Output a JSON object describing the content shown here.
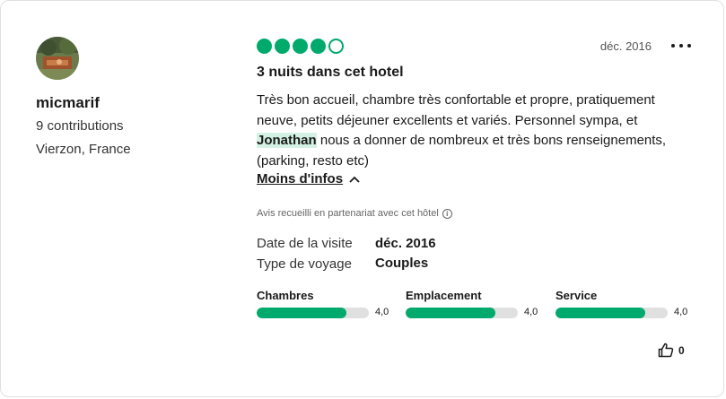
{
  "reviewer": {
    "name": "micmarif",
    "contributions": "9 contributions",
    "location": "Vierzon, France"
  },
  "review": {
    "rating": 4,
    "rating_max": 5,
    "date": "déc. 2016",
    "title": "3 nuits dans cet hotel",
    "text_before": "Très bon accueil, chambre très confortable et propre, pratiquement neuve, petits déjeuner excellents et variés. Personnel sympa, et ",
    "text_highlight": "Jonathan",
    "text_after": " nous a donner de nombreux et très bons renseignements, (parking, resto etc)",
    "less_link": "Moins d'infos",
    "partner_note": "Avis recueilli en partenariat avec cet hôtel",
    "details": [
      {
        "label": "Date de la visite",
        "value": "déc. 2016"
      },
      {
        "label": "Type de voyage",
        "value": "Couples"
      }
    ],
    "subscores": [
      {
        "label": "Chambres",
        "score": "4,0",
        "fraction": 0.8
      },
      {
        "label": "Emplacement",
        "score": "4,0",
        "fraction": 0.8
      },
      {
        "label": "Service",
        "score": "4,0",
        "fraction": 0.8
      }
    ],
    "helpful_count": "0"
  },
  "colors": {
    "accent": "#00aa6c",
    "highlight_bg": "#d3f1e4",
    "bar_bg": "#e0e0e0"
  },
  "icons": {
    "more": "more-dots-icon",
    "chevron": "chevron-up-icon",
    "info": "info-icon",
    "thumbs_up": "thumbs-up-icon"
  }
}
